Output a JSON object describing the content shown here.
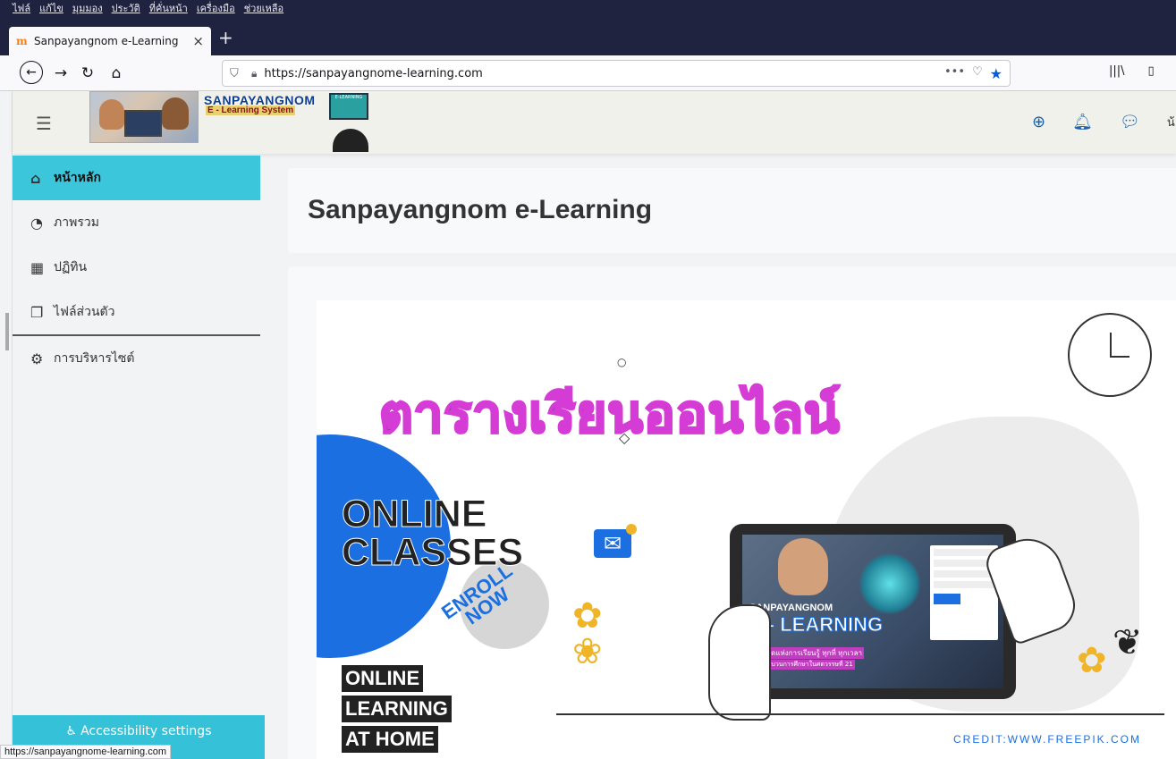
{
  "browser": {
    "menu": [
      "ไฟล์",
      "แก้ไข",
      "มุมมอง",
      "ประวัติ",
      "ที่คั่นหน้า",
      "เครื่องมือ",
      "ช่วยเหลือ"
    ],
    "tab_title": "Sanpayangnom e-Learning",
    "tab_close": "×",
    "new_tab": "+",
    "url": "https://sanpayangnome-learning.com",
    "url_icons": {
      "more": "•••",
      "pocket": "pocket-icon",
      "bookmark": "star-icon"
    },
    "status_url": "https://sanpayangnome-learning.com"
  },
  "header": {
    "logo_title": "SANPAYANGNOM",
    "logo_subtitle": "E - Learning System",
    "device_text": "E-LEARNING",
    "user_initial": "น้"
  },
  "drawer": {
    "items": [
      {
        "label": "หน้าหลัก",
        "icon": "home-icon",
        "active": true
      },
      {
        "label": "ภาพรวม",
        "icon": "dashboard-icon",
        "active": false
      },
      {
        "label": "ปฏิทิน",
        "icon": "calendar-icon",
        "active": false
      },
      {
        "label": "ไฟล์ส่วนตัว",
        "icon": "files-icon",
        "active": false
      }
    ],
    "admin_item": {
      "label": "การบริหารไซต์",
      "icon": "gear-icon"
    },
    "accessibility_label": "Accessibility settings"
  },
  "main": {
    "title": "Sanpayangnom e-Learning",
    "banner": {
      "thai_heading": "ตารางเรียนออนไลน์",
      "online_classes": [
        "ONLINE",
        "CLASSES"
      ],
      "enroll": [
        "ENROLL",
        "NOW"
      ],
      "learning_lines": [
        "ONLINE",
        "LEARNING",
        "AT HOME"
      ],
      "screen_brand": "SANPAYANGNOM",
      "screen_title": "E - LEARNING",
      "screen_tag1": "ห้องสมุดแห่งการเรียนรู้ ทุกที่ ทุกเวลา",
      "screen_tag2": "จัดกระบวนการศึกษาในศตวรรษที่ 21",
      "credit": "CREDIT:WWW.FREEPIK.COM"
    }
  }
}
